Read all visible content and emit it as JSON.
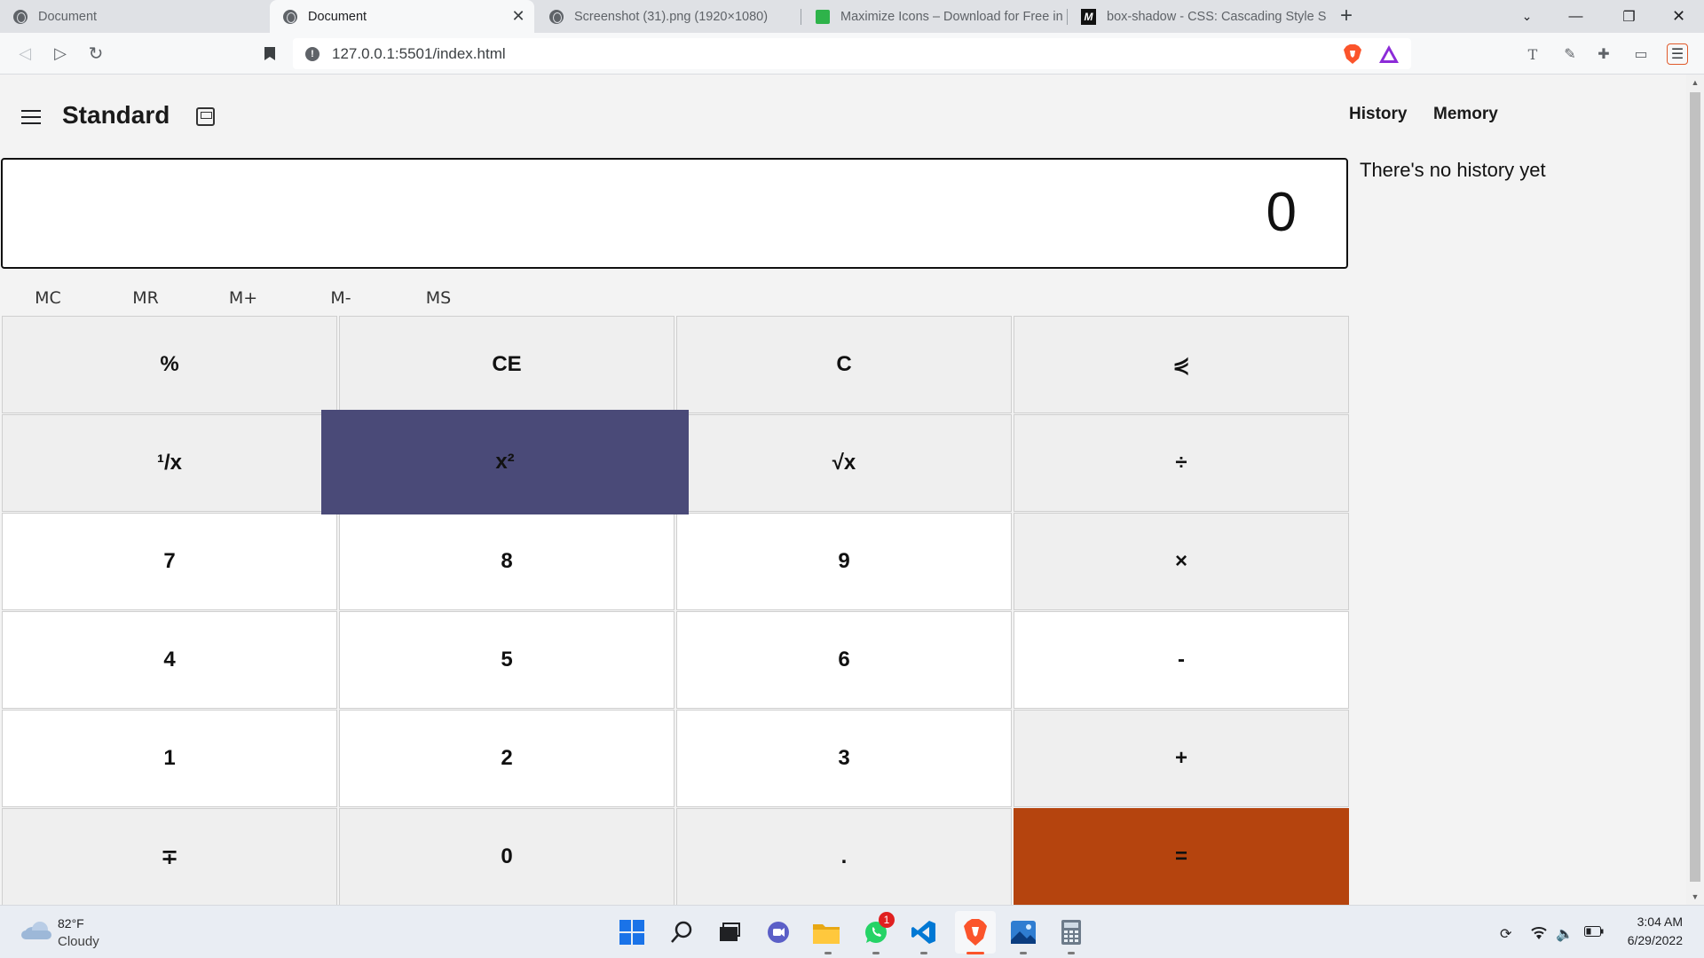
{
  "browser": {
    "tabs": [
      {
        "label": "Document"
      },
      {
        "label": "Document"
      },
      {
        "label": "Screenshot (31).png (1920×1080)"
      },
      {
        "label": "Maximize Icons – Download for Free in"
      },
      {
        "label": "box-shadow - CSS: Cascading Style Sh"
      }
    ],
    "url": "127.0.0.1:5501/index.html"
  },
  "calculator": {
    "mode_title": "Standard",
    "panel_tabs": {
      "history": "History",
      "memory": "Memory"
    },
    "display_value": "0",
    "history_empty": "There's no history yet",
    "memory_buttons": [
      "MC",
      "MR",
      "M+",
      "M-",
      "MS"
    ],
    "keys": [
      [
        "%",
        "CE",
        "C",
        "⋞"
      ],
      [
        "¹/x",
        "x²",
        "√x",
        "÷"
      ],
      [
        "7",
        "8",
        "9",
        "×"
      ],
      [
        "4",
        "5",
        "6",
        "-"
      ],
      [
        "1",
        "2",
        "3",
        "+"
      ],
      [
        "∓",
        "0",
        ".",
        "="
      ]
    ],
    "colors": {
      "hover_key": "#4a4a78",
      "equals_key": "#b5440e"
    }
  },
  "taskbar": {
    "weather": {
      "temp": "82°F",
      "desc": "Cloudy"
    },
    "whatsapp_badge": "1",
    "clock": {
      "time": "3:04 AM",
      "date": "6/29/2022"
    }
  }
}
